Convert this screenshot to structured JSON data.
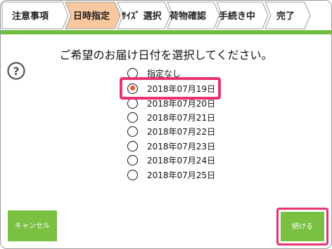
{
  "steps": [
    {
      "label": "注意事項",
      "state": "done"
    },
    {
      "label": "日時指定",
      "state": "active"
    },
    {
      "label": "ｻｲｽﾞ 選択",
      "state": "todo"
    },
    {
      "label": "荷物確認",
      "state": "todo"
    },
    {
      "label": "手続き中",
      "state": "todo"
    },
    {
      "label": "完了",
      "state": "todo"
    }
  ],
  "prompt": "ご希望のお届け日付を選択してください。",
  "help_icon": "question-circle-icon",
  "options": [
    {
      "label": "指定なし",
      "selected": false
    },
    {
      "label": "2018年07月19日",
      "selected": true
    },
    {
      "label": "2018年07月20日",
      "selected": false
    },
    {
      "label": "2018年07月21日",
      "selected": false
    },
    {
      "label": "2018年07月22日",
      "selected": false
    },
    {
      "label": "2018年07月23日",
      "selected": false
    },
    {
      "label": "2018年07月24日",
      "selected": false
    },
    {
      "label": "2018年07月25日",
      "selected": false
    }
  ],
  "buttons": {
    "cancel": "キャンセル",
    "next": "続ける"
  },
  "colors": {
    "accent_green": "#7ac142",
    "active_step": "#f9c89f",
    "highlight": "#e8336e",
    "radio_selected": "#e8552f"
  }
}
